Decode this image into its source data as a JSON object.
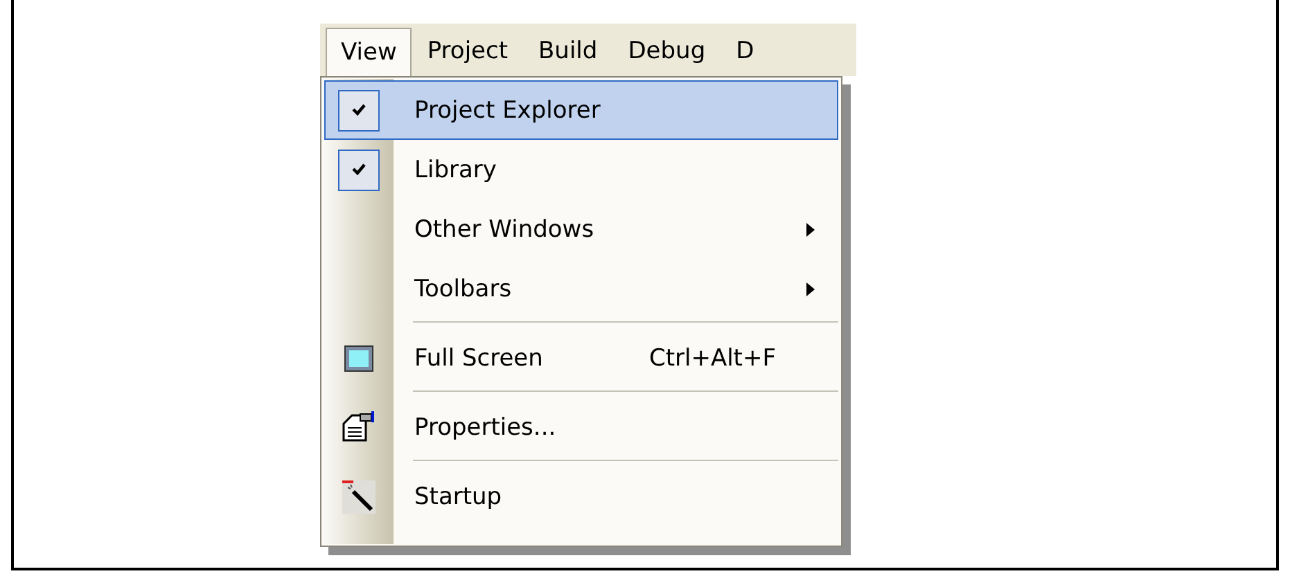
{
  "menubar": [
    {
      "label": "View",
      "selected": true
    },
    {
      "label": "Project",
      "selected": false
    },
    {
      "label": "Build",
      "selected": false
    },
    {
      "label": "Debug",
      "selected": false
    },
    {
      "label": "D",
      "selected": false
    }
  ],
  "menu": [
    {
      "kind": "check",
      "label": "Project Explorer",
      "checked": true,
      "selected": true
    },
    {
      "kind": "check",
      "label": "Library",
      "checked": true,
      "selected": false
    },
    {
      "kind": "plain",
      "label": "Other Windows",
      "submenu": true,
      "selected": false
    },
    {
      "kind": "plain",
      "label": "Toolbars",
      "submenu": true,
      "selected": false
    },
    {
      "kind": "separator"
    },
    {
      "kind": "screen",
      "label": "Full Screen",
      "shortcut": "Ctrl+Alt+F",
      "selected": false
    },
    {
      "kind": "separator"
    },
    {
      "kind": "properties",
      "label": "Properties...",
      "selected": false
    },
    {
      "kind": "separator"
    },
    {
      "kind": "wand",
      "label": "Startup",
      "selected": false
    }
  ]
}
